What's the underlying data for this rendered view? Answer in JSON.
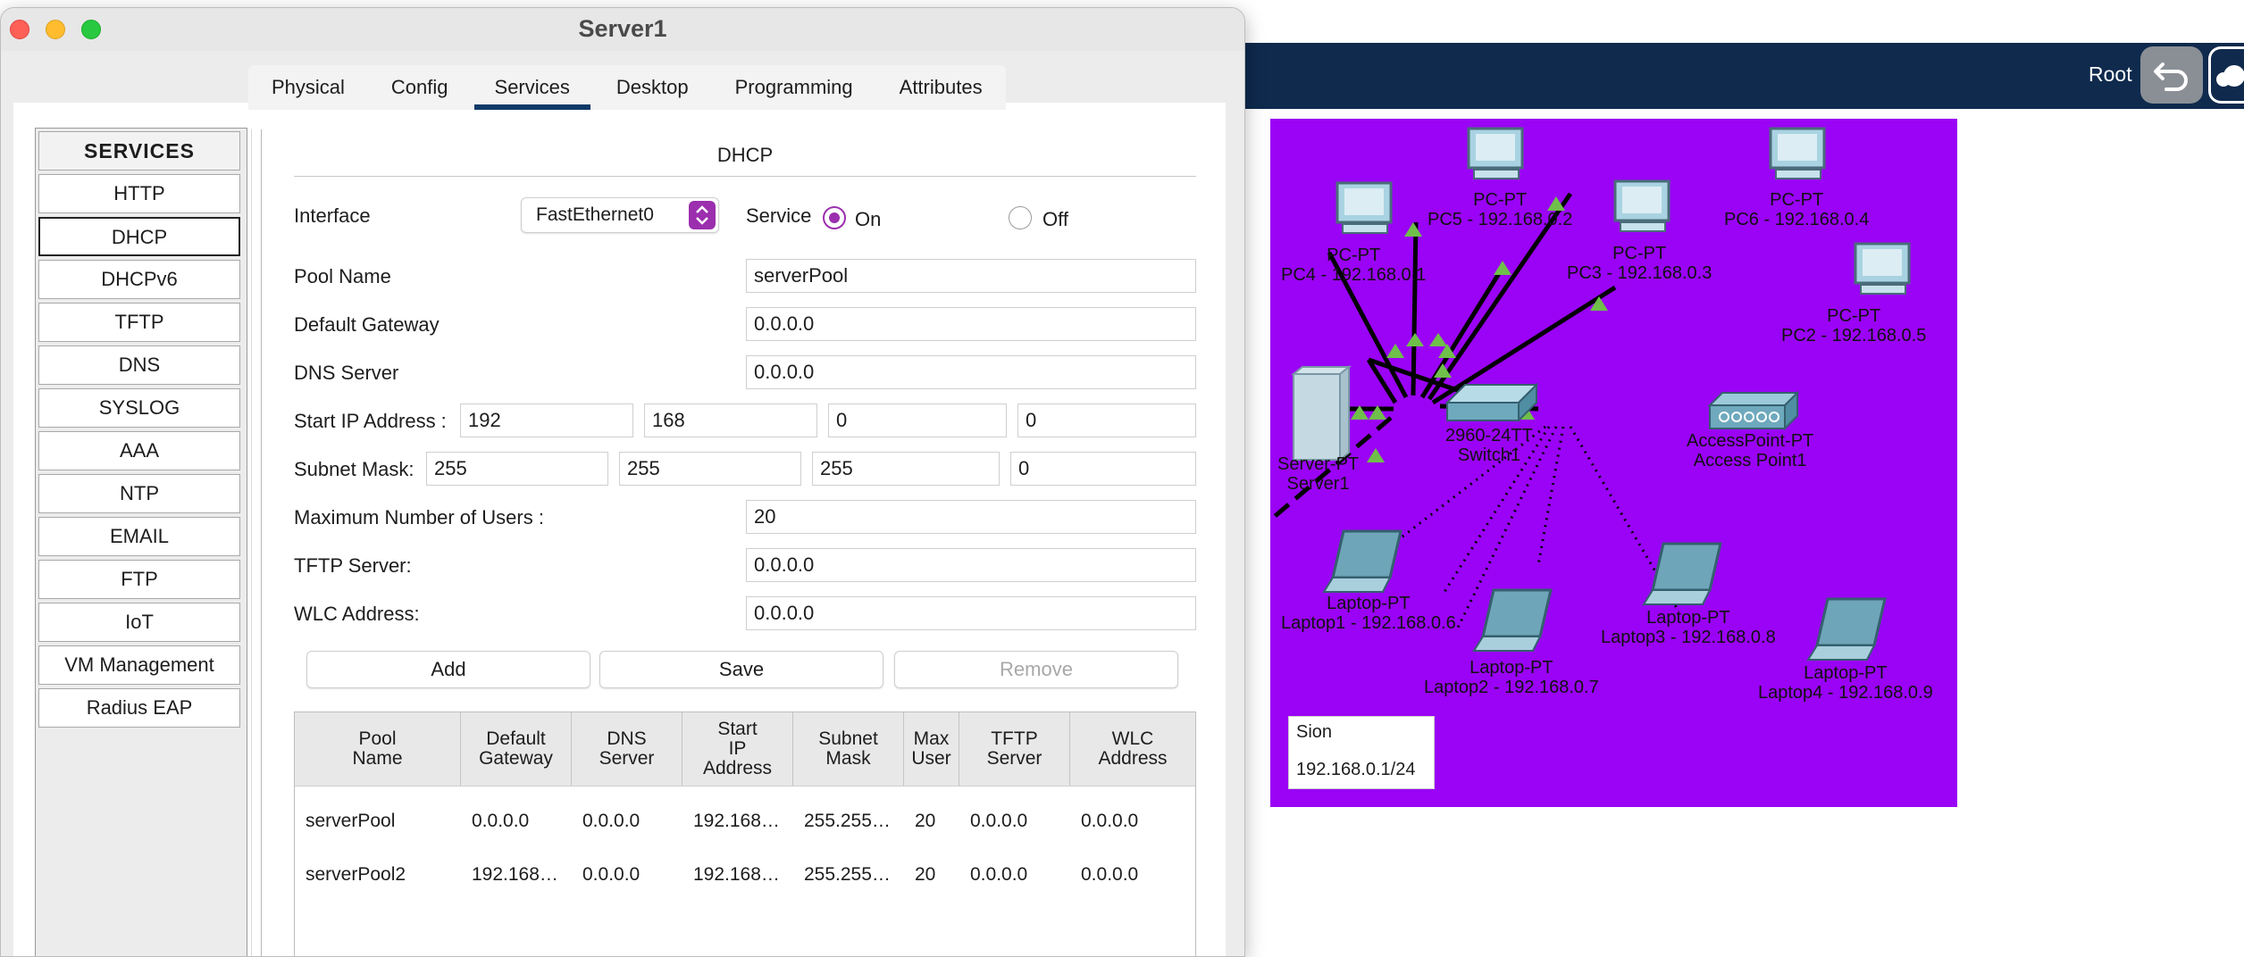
{
  "window": {
    "title": "Server1"
  },
  "tabs": [
    {
      "label": "Physical"
    },
    {
      "label": "Config"
    },
    {
      "label": "Services"
    },
    {
      "label": "Desktop"
    },
    {
      "label": "Programming"
    },
    {
      "label": "Attributes"
    }
  ],
  "active_tab": "Services",
  "services": {
    "header": "SERVICES",
    "items": [
      {
        "label": "HTTP"
      },
      {
        "label": "DHCP"
      },
      {
        "label": "DHCPv6"
      },
      {
        "label": "TFTP"
      },
      {
        "label": "DNS"
      },
      {
        "label": "SYSLOG"
      },
      {
        "label": "AAA"
      },
      {
        "label": "NTP"
      },
      {
        "label": "EMAIL"
      },
      {
        "label": "FTP"
      },
      {
        "label": "IoT"
      },
      {
        "label": "VM Management"
      },
      {
        "label": "Radius EAP"
      }
    ],
    "selected": "DHCP"
  },
  "dhcp": {
    "section_title": "DHCP",
    "interface_label": "Interface",
    "interface_value": "FastEthernet0",
    "service_label": "Service",
    "service_on": "On",
    "service_off": "Off",
    "service_state": "On",
    "pool_name_label": "Pool Name",
    "pool_name": "serverPool",
    "default_gateway_label": "Default Gateway",
    "default_gateway": "0.0.0.0",
    "dns_server_label": "DNS Server",
    "dns_server": "0.0.0.0",
    "start_ip_label": "Start IP Address :",
    "start_ip": [
      "192",
      "168",
      "0",
      "0"
    ],
    "subnet_mask_label": "Subnet Mask:",
    "subnet_mask": [
      "255",
      "255",
      "255",
      "0"
    ],
    "max_users_label": "Maximum Number of Users :",
    "max_users": "20",
    "tftp_server_label": "TFTP Server:",
    "tftp_server": "0.0.0.0",
    "wlc_address_label": "WLC Address:",
    "wlc_address": "0.0.0.0",
    "buttons": {
      "add": "Add",
      "save": "Save",
      "remove": "Remove"
    },
    "table": {
      "columns": [
        "Pool\nName",
        "Default\nGateway",
        "DNS\nServer",
        "Start\nIP\nAddress",
        "Subnet\nMask",
        "Max\nUser",
        "TFTP\nServer",
        "WLC\nAddress"
      ],
      "rows": [
        [
          "serverPool",
          "0.0.0.0",
          "0.0.0.0",
          "192.168…",
          "255.255…",
          "20",
          "0.0.0.0",
          "0.0.0.0"
        ],
        [
          "serverPool2",
          "192.168…",
          "0.0.0.0",
          "192.168…",
          "255.255…",
          "20",
          "0.0.0.0",
          "0.0.0.0"
        ]
      ]
    }
  },
  "workspace": {
    "user_label": "Root",
    "background_color": "#9a03f5",
    "note": {
      "line1": "Sion",
      "line2": "192.168.0.1/24"
    },
    "devices": [
      {
        "id": "pc4",
        "type_label": "PC-PT",
        "name_label": "PC4 - 192.168.0.1"
      },
      {
        "id": "pc5",
        "type_label": "PC-PT",
        "name_label": "PC5 - 192.168.0.2"
      },
      {
        "id": "pc3",
        "type_label": "PC-PT",
        "name_label": "PC3 - 192.168.0.3"
      },
      {
        "id": "pc6",
        "type_label": "PC-PT",
        "name_label": "PC6 - 192.168.0.4"
      },
      {
        "id": "pc2",
        "type_label": "PC-PT",
        "name_label": "PC2 - 192.168.0.5"
      },
      {
        "id": "switch1",
        "type_label": "2960-24TT",
        "name_label": "Switch1"
      },
      {
        "id": "ap1",
        "type_label": "AccessPoint-PT",
        "name_label": "Access Point1"
      },
      {
        "id": "server1",
        "type_label": "Server-PT",
        "name_label": "Server1"
      },
      {
        "id": "laptop1",
        "type_label": "Laptop-PT",
        "name_label": "Laptop1 - 192.168.0.6"
      },
      {
        "id": "laptop2",
        "type_label": "Laptop-PT",
        "name_label": "Laptop2 - 192.168.0.7"
      },
      {
        "id": "laptop3",
        "type_label": "Laptop-PT",
        "name_label": "Laptop3 - 192.168.0.8"
      },
      {
        "id": "laptop4",
        "type_label": "Laptop-PT",
        "name_label": "Laptop4 - 192.168.0.9"
      }
    ]
  }
}
